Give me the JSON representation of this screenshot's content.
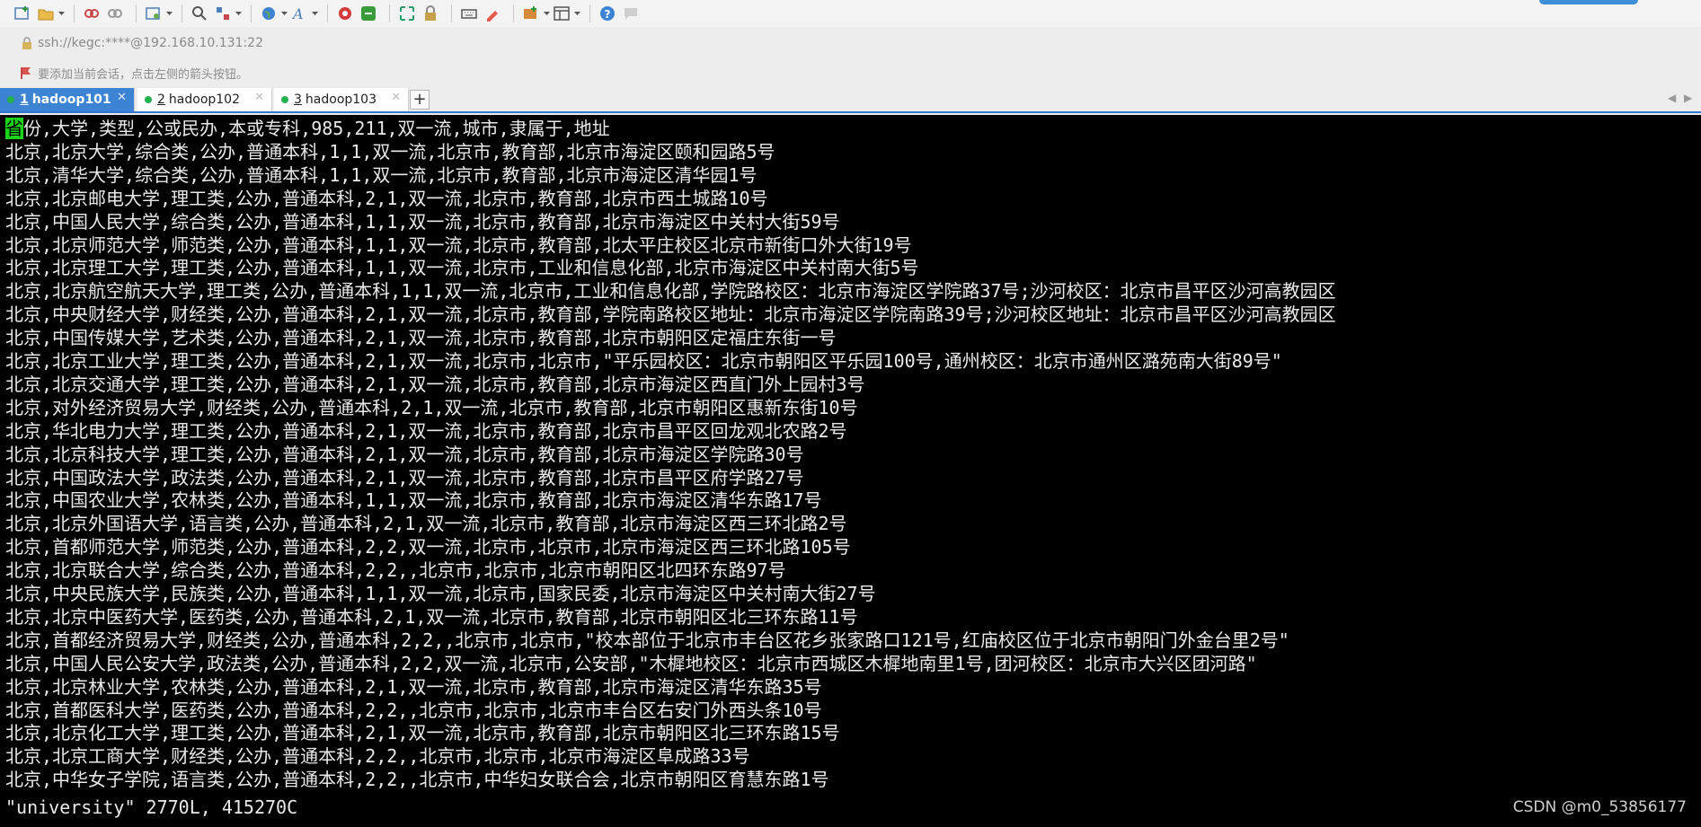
{
  "address": {
    "url": "ssh://kegc:****@192.168.10.131:22"
  },
  "hint": {
    "text": "要添加当前会话，点击左侧的箭头按钮。"
  },
  "tabs": [
    {
      "num": "1",
      "label": "hadoop101",
      "active": true
    },
    {
      "num": "2",
      "label": "hadoop102",
      "active": false
    },
    {
      "num": "3",
      "label": "hadoop103",
      "active": false
    }
  ],
  "terminal": {
    "cursor_char": "省",
    "header_rest": "份,大学,类型,公或民办,本或专科,985,211,双一流,城市,隶属于,地址",
    "lines": [
      "北京,北京大学,综合类,公办,普通本科,1,1,双一流,北京市,教育部,北京市海淀区颐和园路5号",
      "北京,清华大学,综合类,公办,普通本科,1,1,双一流,北京市,教育部,北京市海淀区清华园1号",
      "北京,北京邮电大学,理工类,公办,普通本科,2,1,双一流,北京市,教育部,北京市西土城路10号",
      "北京,中国人民大学,综合类,公办,普通本科,1,1,双一流,北京市,教育部,北京市海淀区中关村大街59号",
      "北京,北京师范大学,师范类,公办,普通本科,1,1,双一流,北京市,教育部,北太平庄校区北京市新街口外大街19号",
      "北京,北京理工大学,理工类,公办,普通本科,1,1,双一流,北京市,工业和信息化部,北京市海淀区中关村南大街5号",
      "北京,北京航空航天大学,理工类,公办,普通本科,1,1,双一流,北京市,工业和信息化部,学院路校区：北京市海淀区学院路37号;沙河校区：北京市昌平区沙河高教园区",
      "北京,中央财经大学,财经类,公办,普通本科,2,1,双一流,北京市,教育部,学院南路校区地址：北京市海淀区学院南路39号;沙河校区地址：北京市昌平区沙河高教园区",
      "北京,中国传媒大学,艺术类,公办,普通本科,2,1,双一流,北京市,教育部,北京市朝阳区定福庄东街一号",
      "北京,北京工业大学,理工类,公办,普通本科,2,1,双一流,北京市,北京市,\"平乐园校区：北京市朝阳区平乐园100号,通州校区：北京市通州区潞苑南大街89号\"",
      "北京,北京交通大学,理工类,公办,普通本科,2,1,双一流,北京市,教育部,北京市海淀区西直门外上园村3号",
      "北京,对外经济贸易大学,财经类,公办,普通本科,2,1,双一流,北京市,教育部,北京市朝阳区惠新东街10号",
      "北京,华北电力大学,理工类,公办,普通本科,2,1,双一流,北京市,教育部,北京市昌平区回龙观北农路2号",
      "北京,北京科技大学,理工类,公办,普通本科,2,1,双一流,北京市,教育部,北京市海淀区学院路30号",
      "北京,中国政法大学,政法类,公办,普通本科,2,1,双一流,北京市,教育部,北京市昌平区府学路27号",
      "北京,中国农业大学,农林类,公办,普通本科,1,1,双一流,北京市,教育部,北京市海淀区清华东路17号",
      "北京,北京外国语大学,语言类,公办,普通本科,2,1,双一流,北京市,教育部,北京市海淀区西三环北路2号",
      "北京,首都师范大学,师范类,公办,普通本科,2,2,双一流,北京市,北京市,北京市海淀区西三环北路105号",
      "北京,北京联合大学,综合类,公办,普通本科,2,2,,北京市,北京市,北京市朝阳区北四环东路97号",
      "北京,中央民族大学,民族类,公办,普通本科,1,1,双一流,北京市,国家民委,北京市海淀区中关村南大街27号",
      "北京,北京中医药大学,医药类,公办,普通本科,2,1,双一流,北京市,教育部,北京市朝阳区北三环东路11号",
      "北京,首都经济贸易大学,财经类,公办,普通本科,2,2,,北京市,北京市,\"校本部位于北京市丰台区花乡张家路口121号,红庙校区位于北京市朝阳门外金台里2号\"",
      "北京,中国人民公安大学,政法类,公办,普通本科,2,2,双一流,北京市,公安部,\"木樨地校区：北京市西城区木樨地南里1号,团河校区：北京市大兴区团河路\"",
      "北京,北京林业大学,农林类,公办,普通本科,2,1,双一流,北京市,教育部,北京市海淀区清华东路35号",
      "北京,首都医科大学,医药类,公办,普通本科,2,2,,北京市,北京市,北京市丰台区右安门外西头条10号",
      "北京,北京化工大学,理工类,公办,普通本科,2,1,双一流,北京市,教育部,北京市朝阳区北三环东路15号",
      "北京,北京工商大学,财经类,公办,普通本科,2,2,,北京市,北京市,北京市海淀区阜成路33号",
      "北京,中华女子学院,语言类,公办,普通本科,2,2,,北京市,中华妇女联合会,北京市朝阳区育慧东路1号"
    ],
    "status": "\"university\" 2770L, 415270C"
  },
  "watermark": "CSDN @m0_53856177",
  "colors": {
    "terminal_bg": "#000000",
    "terminal_fg": "#e9e9e9",
    "cursor": "#19d419",
    "active_tab": "#3c83d4",
    "session_dot": "#23b14d"
  }
}
